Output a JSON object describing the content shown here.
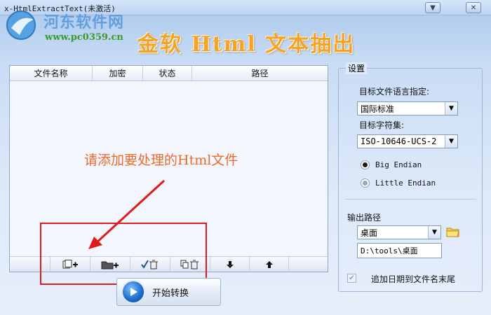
{
  "window": {
    "title": "x-HtmlExtractText(未激活)",
    "minimize_icon": "chevron-down-icon",
    "close_icon": "close-icon"
  },
  "watermark": {
    "site_name": "河东软件网",
    "url": "www.pc0359.cn"
  },
  "banner": {
    "title": "金软 Html 文本抽出"
  },
  "file_list": {
    "columns": [
      "文件名称",
      "加密",
      "状态",
      "路径"
    ],
    "hint": "请添加要处理的Html文件",
    "toolbar": [
      {
        "name": "add-file-button",
        "icon": "add-file-icon"
      },
      {
        "name": "add-folder-button",
        "icon": "add-folder-icon"
      },
      {
        "name": "remove-selected-button",
        "icon": "check-delete-icon"
      },
      {
        "name": "remove-all-button",
        "icon": "copy-delete-icon"
      },
      {
        "name": "move-down-button",
        "icon": "arrow-down-icon"
      },
      {
        "name": "move-up-button",
        "icon": "arrow-up-icon"
      }
    ]
  },
  "start": {
    "label": "开始转换",
    "icon": "play-icon"
  },
  "settings": {
    "legend": "设置",
    "target_lang_label": "目标文件语言指定:",
    "target_lang_value": "国际标准",
    "charset_label": "目标字符集:",
    "charset_value": "ISO-10646-UCS-2",
    "endian_options": [
      {
        "label": "Big Endian",
        "selected": true
      },
      {
        "label": "Little Endian",
        "selected": false
      }
    ],
    "output_label": "输出路径",
    "output_value": "桌面",
    "output_path": "D:\\tools\\桌面",
    "append_date_label": "追加日期到文件名末尾",
    "append_date_checked": true
  },
  "colors": {
    "banner": "#f6a323",
    "hint": "#ec6a2c",
    "annotation": "#e01b1b"
  }
}
